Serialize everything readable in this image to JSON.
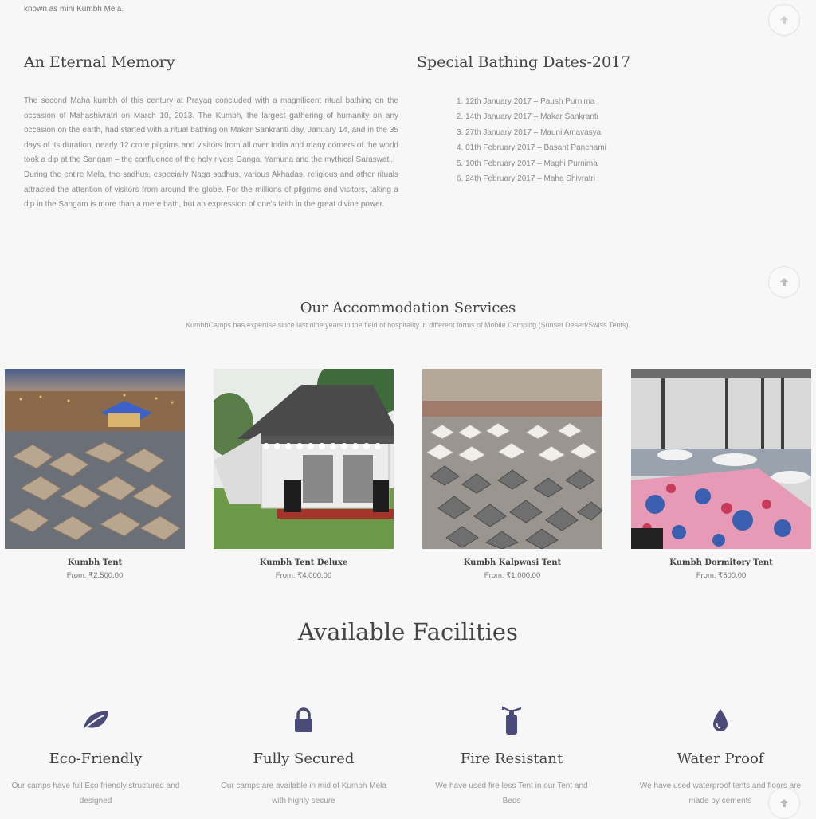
{
  "intro": {
    "tail_text": "known as mini Kumbh Mela."
  },
  "memory": {
    "title": "An Eternal Memory",
    "para1": "The second Maha kumbh of this century at Prayag concluded with a magnificent ritual bathing on the occasion of Mahashivratri on March 10, 2013. The Kumbh, the largest gathering of humanity on any occasion on the earth, had started with a ritual bathing on Makar Sankranti day, January 14, and in the 35 days of its duration, nearly 12 crore pilgrims and visitors from all over India and many corners of the world took a dip at the Sangam – the confluence of the holy rivers Ganga, Yamuna and the mythical Saraswati.",
    "para2": "During the entire Mela, the sadhus, especially Naga sadhus, various Akhadas, religious and other rituals attracted the attention of visitors from around the globe. For the millions of pilgrims and visitors, taking a dip in the Sangam is more than a mere bath, but an expression of one's faith in the great divine power."
  },
  "bathing": {
    "title": "Special Bathing Dates-2017",
    "dates": [
      "1. 12th January 2017 – Paush Purnima",
      "2. 14th January 2017 – Makar Sankranti",
      "3. 27th January 2017 – Mauni Amavasya",
      "4. 01th February 2017 – Basant Panchami",
      "5. 10th February 2017 – Maghi Purnima",
      "6. 24th February 2017 – Maha Shivratri"
    ]
  },
  "accommodation": {
    "title": "Our Accommodation Services",
    "subtitle": "KumbhCamps has expertise since last nine years in the field of hospitality in different forms of Mobile Camping (Sunset Desert/Swiss Tents).",
    "cards": [
      {
        "name": "Kumbh Tent",
        "price": "From: ₹2,500.00"
      },
      {
        "name": "Kumbh Tent Deluxe",
        "price": "From: ₹4,000.00"
      },
      {
        "name": "Kumbh Kalpwasi Tent",
        "price": "From: ₹1,000.00"
      },
      {
        "name": "Kumbh Dormitory Tent",
        "price": "From: ₹500.00"
      }
    ]
  },
  "facilities": {
    "title": "Available Facilities",
    "items": [
      {
        "icon": "leaf-icon",
        "title": "Eco-Friendly",
        "desc": "Our camps have full Eco friendly structured and designed"
      },
      {
        "icon": "lock-icon",
        "title": "Fully Secured",
        "desc": "Our camps are available in mid of Kumbh Mela with highly secure"
      },
      {
        "icon": "fire-extinguisher-icon",
        "title": "Fire Resistant",
        "desc": "We have used fire less Tent in our Tent and Beds"
      },
      {
        "icon": "water-drop-icon",
        "title": "Water Proof",
        "desc": "We have used waterproof tents and floors are made by cements"
      }
    ]
  },
  "colors": {
    "icon": "#4b4b7a",
    "background": "#f7f7f7",
    "heading": "#444444"
  }
}
